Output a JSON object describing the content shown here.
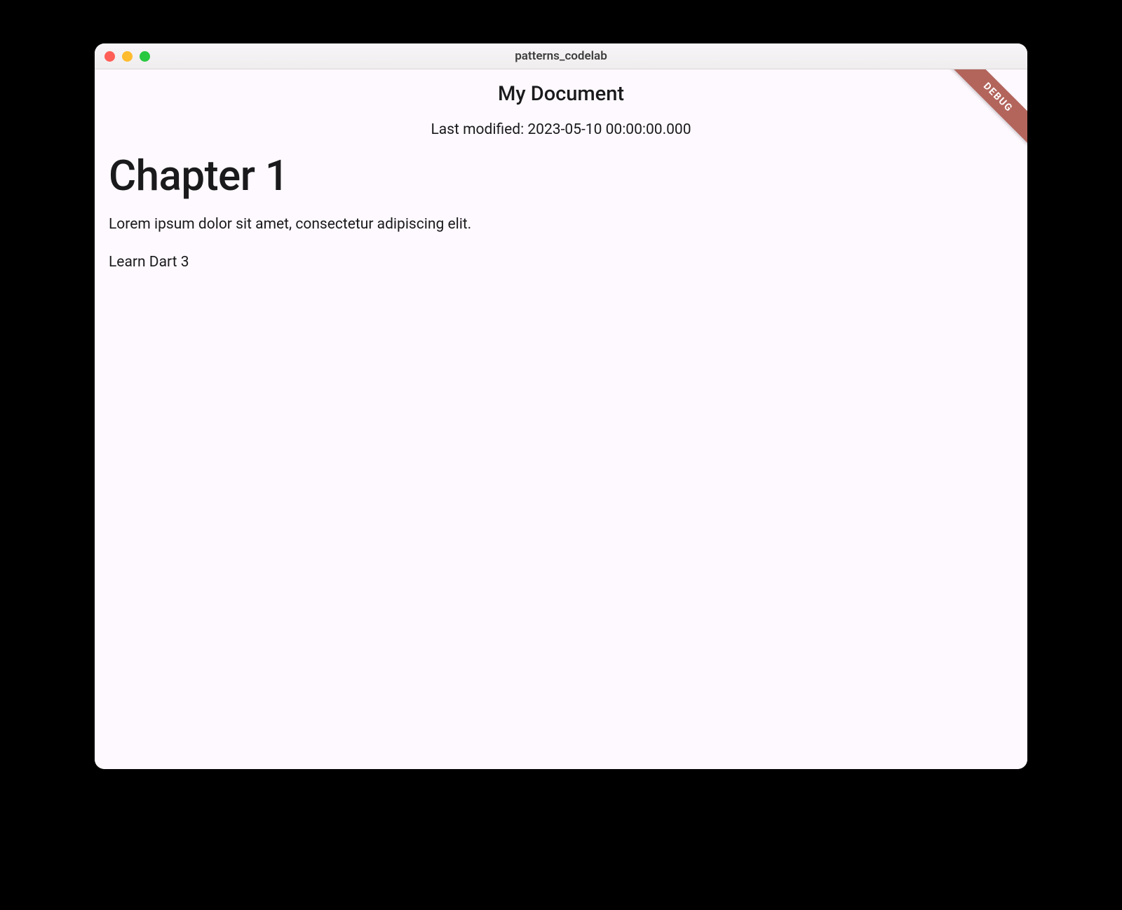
{
  "window": {
    "title": "patterns_codelab"
  },
  "app": {
    "title": "My Document",
    "last_modified": "Last modified: 2023-05-10 00:00:00.000"
  },
  "content": {
    "heading": "Chapter 1",
    "paragraph": "Lorem ipsum dolor sit amet, consectetur adipiscing elit.",
    "checkbox_item": "Learn Dart 3"
  },
  "debug": {
    "label": "DEBUG"
  }
}
